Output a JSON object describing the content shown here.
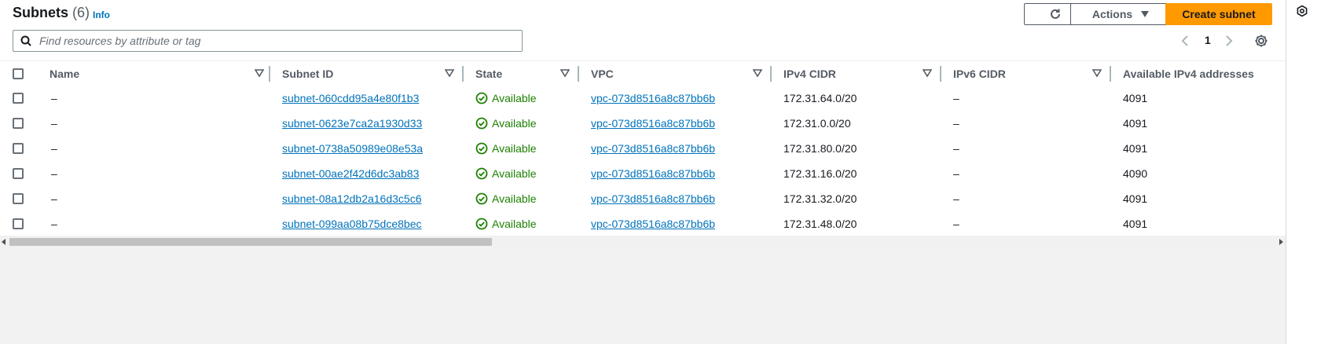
{
  "header": {
    "title": "Subnets",
    "count": "(6)",
    "info_link": "Info"
  },
  "toolbar": {
    "refresh_icon": "refresh-icon",
    "actions_label": "Actions",
    "create_label": "Create subnet"
  },
  "search": {
    "placeholder": "Find resources by attribute or tag",
    "value": ""
  },
  "pagination": {
    "current_page": "1"
  },
  "table": {
    "columns": [
      "Name",
      "Subnet ID",
      "State",
      "VPC",
      "IPv4 CIDR",
      "IPv6 CIDR",
      "Available IPv4 addresses"
    ],
    "rows": [
      {
        "name": "–",
        "subnet_id": "subnet-060cdd95a4e80f1b3",
        "state": "Available",
        "vpc": "vpc-073d8516a8c87bb6b",
        "ipv4": "172.31.64.0/20",
        "ipv6": "–",
        "available": "4091"
      },
      {
        "name": "–",
        "subnet_id": "subnet-0623e7ca2a1930d33",
        "state": "Available",
        "vpc": "vpc-073d8516a8c87bb6b",
        "ipv4": "172.31.0.0/20",
        "ipv6": "–",
        "available": "4091"
      },
      {
        "name": "–",
        "subnet_id": "subnet-0738a50989e08e53a",
        "state": "Available",
        "vpc": "vpc-073d8516a8c87bb6b",
        "ipv4": "172.31.80.0/20",
        "ipv6": "–",
        "available": "4091"
      },
      {
        "name": "–",
        "subnet_id": "subnet-00ae2f42d6dc3ab83",
        "state": "Available",
        "vpc": "vpc-073d8516a8c87bb6b",
        "ipv4": "172.31.16.0/20",
        "ipv6": "–",
        "available": "4090"
      },
      {
        "name": "–",
        "subnet_id": "subnet-08a12db2a16d3c5c6",
        "state": "Available",
        "vpc": "vpc-073d8516a8c87bb6b",
        "ipv4": "172.31.32.0/20",
        "ipv6": "–",
        "available": "4091"
      },
      {
        "name": "–",
        "subnet_id": "subnet-099aa08b75dce8bec",
        "state": "Available",
        "vpc": "vpc-073d8516a8c87bb6b",
        "ipv4": "172.31.48.0/20",
        "ipv6": "–",
        "available": "4091"
      }
    ]
  },
  "colors": {
    "primary": "#ff9900",
    "link": "#0073bb",
    "success": "#1d8102"
  }
}
